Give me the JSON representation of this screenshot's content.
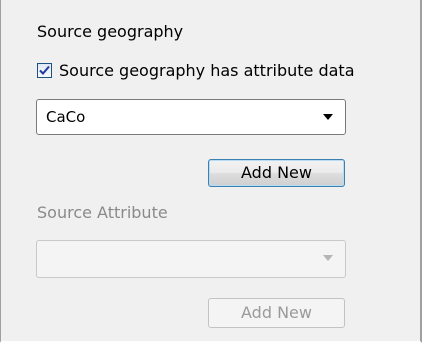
{
  "source_geography": {
    "heading": "Source geography",
    "has_attribute_checkbox": {
      "label": "Source geography has attribute data",
      "checked": true
    },
    "combo": {
      "selected": "CaCo"
    },
    "add_new_label": "Add New"
  },
  "source_attribute": {
    "heading": "Source Attribute",
    "combo": {
      "selected": ""
    },
    "add_new_label": "Add New"
  }
}
